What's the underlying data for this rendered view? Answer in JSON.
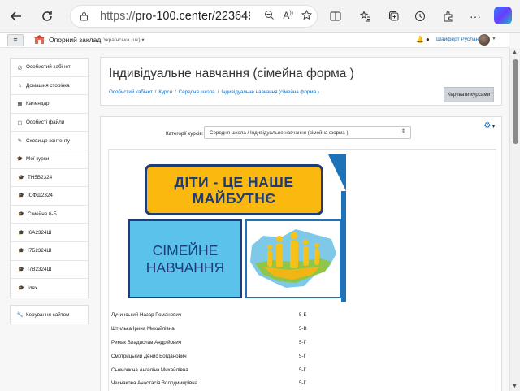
{
  "browser": {
    "url_protocol": "https://",
    "url_rest": "pro-100.center/22364961...",
    "back_icon": "arrow-left-icon",
    "refresh_icon": "refresh-icon"
  },
  "navbar": {
    "site_name": "Опорний заклад",
    "language": "Українська (uk) ▾",
    "user_name": "Шайферт Руслана"
  },
  "sidebar": {
    "items": [
      {
        "label": "Особистий кабінет",
        "icon": "dashboard-icon"
      },
      {
        "label": "Домашня сторінка",
        "icon": "home-icon"
      },
      {
        "label": "Календар",
        "icon": "calendar-icon"
      },
      {
        "label": "Особисті файли",
        "icon": "file-icon"
      },
      {
        "label": "Сховище контенту",
        "icon": "pencil-icon"
      },
      {
        "label": "Мої курси",
        "icon": "graduation-cap-icon"
      },
      {
        "label": "ТН5В2324",
        "icon": "graduation-cap-icon"
      },
      {
        "label": "ІСФШ2324",
        "icon": "graduation-cap-icon"
      },
      {
        "label": "Сімейне 6-Б",
        "icon": "graduation-cap-icon"
      },
      {
        "label": "І6А2324Ш",
        "icon": "graduation-cap-icon"
      },
      {
        "label": "І7Б2324Ш",
        "icon": "graduation-cap-icon"
      },
      {
        "label": "І7В2324Ш",
        "icon": "graduation-cap-icon"
      },
      {
        "label": "Ілях",
        "icon": "graduation-cap-icon"
      }
    ],
    "admin_label": "Керування сайтом"
  },
  "header": {
    "title": "Індивідуальне навчання (сімейна форма )",
    "breadcrumb": [
      "Особистий кабінет",
      "Курси",
      "Середня школа",
      "Індивідуальне навчання (сімейна форма )"
    ],
    "manage_button": "Керувати курсами"
  },
  "main": {
    "category_label": "Категорії курсів:",
    "category_value": "Середня школа / Індивідуальне навчання (сімейна форма )",
    "banner": {
      "line1": "ДІТИ - ЦЕ НАШЕ",
      "line2": "МАЙБУТНЄ",
      "line3": "СІМЕЙНЕ",
      "line4": "НАВЧАННЯ"
    },
    "students": [
      {
        "name": "Лучинський Назар Романович",
        "class": "5-Б"
      },
      {
        "name": "Штилька Ірина Михайлівна",
        "class": "5-В"
      },
      {
        "name": "Римак Владислав Андрійович",
        "class": "5-Г"
      },
      {
        "name": "Смотрицький Денис Богданович",
        "class": "5-Г"
      },
      {
        "name": "Сьомочкіна Ангеліна Михайлівна",
        "class": "5-Г"
      },
      {
        "name": "Чеснакова Анастасія Володимирівна",
        "class": "5-Г"
      }
    ]
  }
}
